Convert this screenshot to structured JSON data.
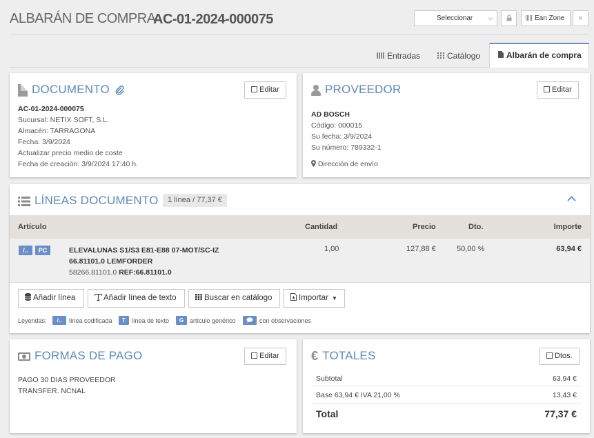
{
  "header": {
    "title": "ALBARÁN DE COMPRA",
    "doc_number": "AC-01-2024-000075",
    "select_value": "Seleccionar",
    "ean_label": "Ean Zone",
    "close_glyph": "×"
  },
  "tabs": [
    {
      "label": "Entradas",
      "icon": "list-icon"
    },
    {
      "label": "Catálogo",
      "icon": "grid-icon"
    },
    {
      "label": "Albarán de compra",
      "icon": "file-icon",
      "active": true
    }
  ],
  "documento": {
    "title": "DOCUMENTO",
    "edit_label": "Editar",
    "number": "AC-01-2024-000075",
    "lines": [
      "Sucursal: NETIX SOFT, S.L.",
      "Almacén: TARRAGONA",
      "Fecha: 3/9/2024",
      "Actualizar precio medio de coste",
      "Fecha de creación: 3/9/2024 17:40 h."
    ]
  },
  "proveedor": {
    "title": "PROVEEDOR",
    "edit_label": "Editar",
    "name": "AD BOSCH",
    "lines": [
      "Código: 000015",
      "Su fecha: 3/9/2024",
      "Su número: 789332-1"
    ],
    "shipping": "Dirección de envío"
  },
  "lineas": {
    "title": "LÍNEAS DOCUMENTO",
    "badge": "1 línea / 77,37 €",
    "columns": {
      "articulo": "Artículo",
      "cantidad": "Cantidad",
      "precio": "Precio",
      "dto": "Dto.",
      "importe": "Importe"
    },
    "rows": [
      {
        "tags": [
          "/..",
          "PC"
        ],
        "desc1": "ELEVALUNAS S1/S3 E81-E88 07-MOT/SC-IZ",
        "desc2": "66.81101.0 LEMFORDER",
        "ref_code": "58266.81101.0",
        "ref_label": "REF:66.81101.0",
        "cantidad": "1,00",
        "precio": "127,88 €",
        "dto": "50,00 %",
        "importe": "63,94 €"
      }
    ],
    "actions": {
      "add_line": "Añadir línea",
      "add_text": "Añadir línea de texto",
      "search_catalog": "Buscar en catálogo",
      "import": "Importar"
    },
    "legend": {
      "label": "Leyendas:",
      "coded_tag": "/..",
      "coded": "línea codificada",
      "text_tag": "T",
      "text": "línea de texto",
      "generic_tag": "G",
      "generic": "artículo genérico",
      "obs": "con observaciones"
    }
  },
  "pago": {
    "title": "FORMAS DE PAGO",
    "edit_label": "Editar",
    "lines": [
      "PAGO 30 DIAS PROVEEDOR",
      "TRANSFER. NCNAL"
    ]
  },
  "totales": {
    "title": "TOTALES",
    "dtos_label": "Dtos.",
    "currency_glyph": "€",
    "subtotal_label": "Subtotal",
    "subtotal": "63,94 €",
    "base_label": "Base 63,94 € IVA 21,00 %",
    "base": "13,43 €",
    "total_label": "Total",
    "total": "77,37 €"
  },
  "colors": {
    "accent": "#5c8ab8",
    "tag": "#6a8fc7",
    "table_header": "#e4e1dc"
  }
}
